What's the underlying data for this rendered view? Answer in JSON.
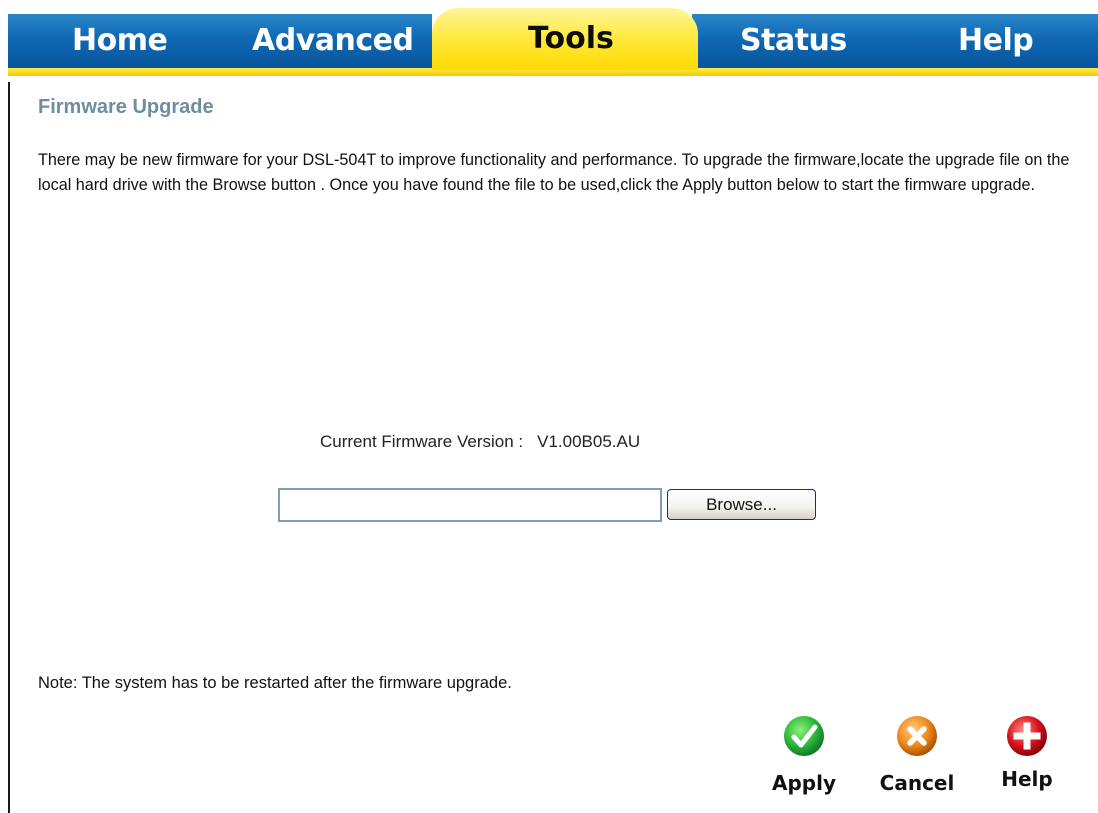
{
  "tabs": {
    "home": "Home",
    "advanced": "Advanced",
    "tools": "Tools",
    "status": "Status",
    "help": "Help",
    "active": "tools"
  },
  "page": {
    "title": "Firmware Upgrade",
    "description": "There may be new firmware for your DSL-504T to improve functionality and performance. To upgrade the firmware,locate the upgrade file on the local hard drive with the Browse button . Once you have found the file to be used,click the Apply button below to start the firmware upgrade.",
    "version_label": "Current Firmware Version :",
    "version_value": "V1.00B05.AU",
    "file_input_value": "",
    "browse_label": "Browse...",
    "note": "Note: The system has to be restarted after the firmware upgrade."
  },
  "actions": {
    "apply": {
      "label": "Apply",
      "icon": "check-icon",
      "color": "#2db83d"
    },
    "cancel": {
      "label": "Cancel",
      "icon": "x-icon",
      "color": "#f08a1c"
    },
    "help": {
      "label": "Help",
      "icon": "plus-icon",
      "color": "#d8141c"
    }
  },
  "colors": {
    "tab_blue": "#1068b4",
    "tab_active_yellow": "#ffe93a",
    "title_color": "#6e8ea0"
  }
}
